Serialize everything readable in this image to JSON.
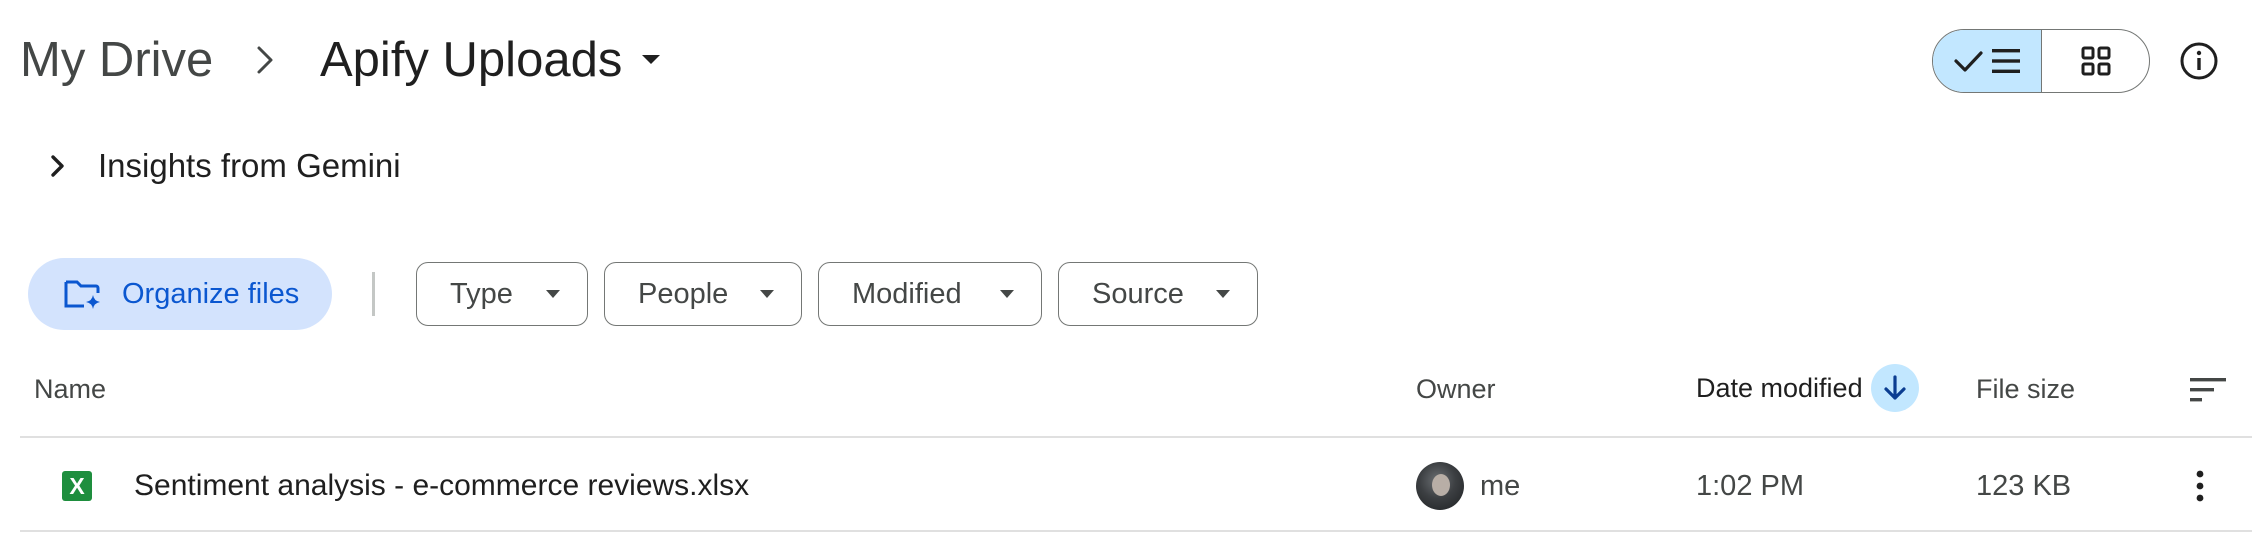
{
  "breadcrumb": {
    "root": "My Drive",
    "current": "Apify Uploads",
    "separator_icon": "chevron-right-icon",
    "dropdown_icon": "caret-down-icon"
  },
  "view_toggle": {
    "selected": "list",
    "options": [
      "list",
      "grid"
    ]
  },
  "gemini": {
    "label": "Insights from Gemini",
    "expanded": false
  },
  "toolbar": {
    "organize_label": "Organize files",
    "filters": [
      "Type",
      "People",
      "Modified",
      "Source"
    ]
  },
  "table": {
    "columns": {
      "name": "Name",
      "owner": "Owner",
      "date_modified": "Date modified",
      "file_size": "File size"
    },
    "sort": "descending",
    "rows": [
      {
        "name": "Sentiment analysis - e-commerce reviews.xlsx",
        "icon_letter": "X",
        "owner": "me",
        "date_modified": "1:02 PM",
        "file_size": "123 KB"
      }
    ]
  },
  "colors": {
    "accent_light": "#c2e7ff",
    "organize_bg": "#d3e3fd",
    "organize_text": "#0b57d0",
    "excel_green": "#1e8e3e"
  }
}
